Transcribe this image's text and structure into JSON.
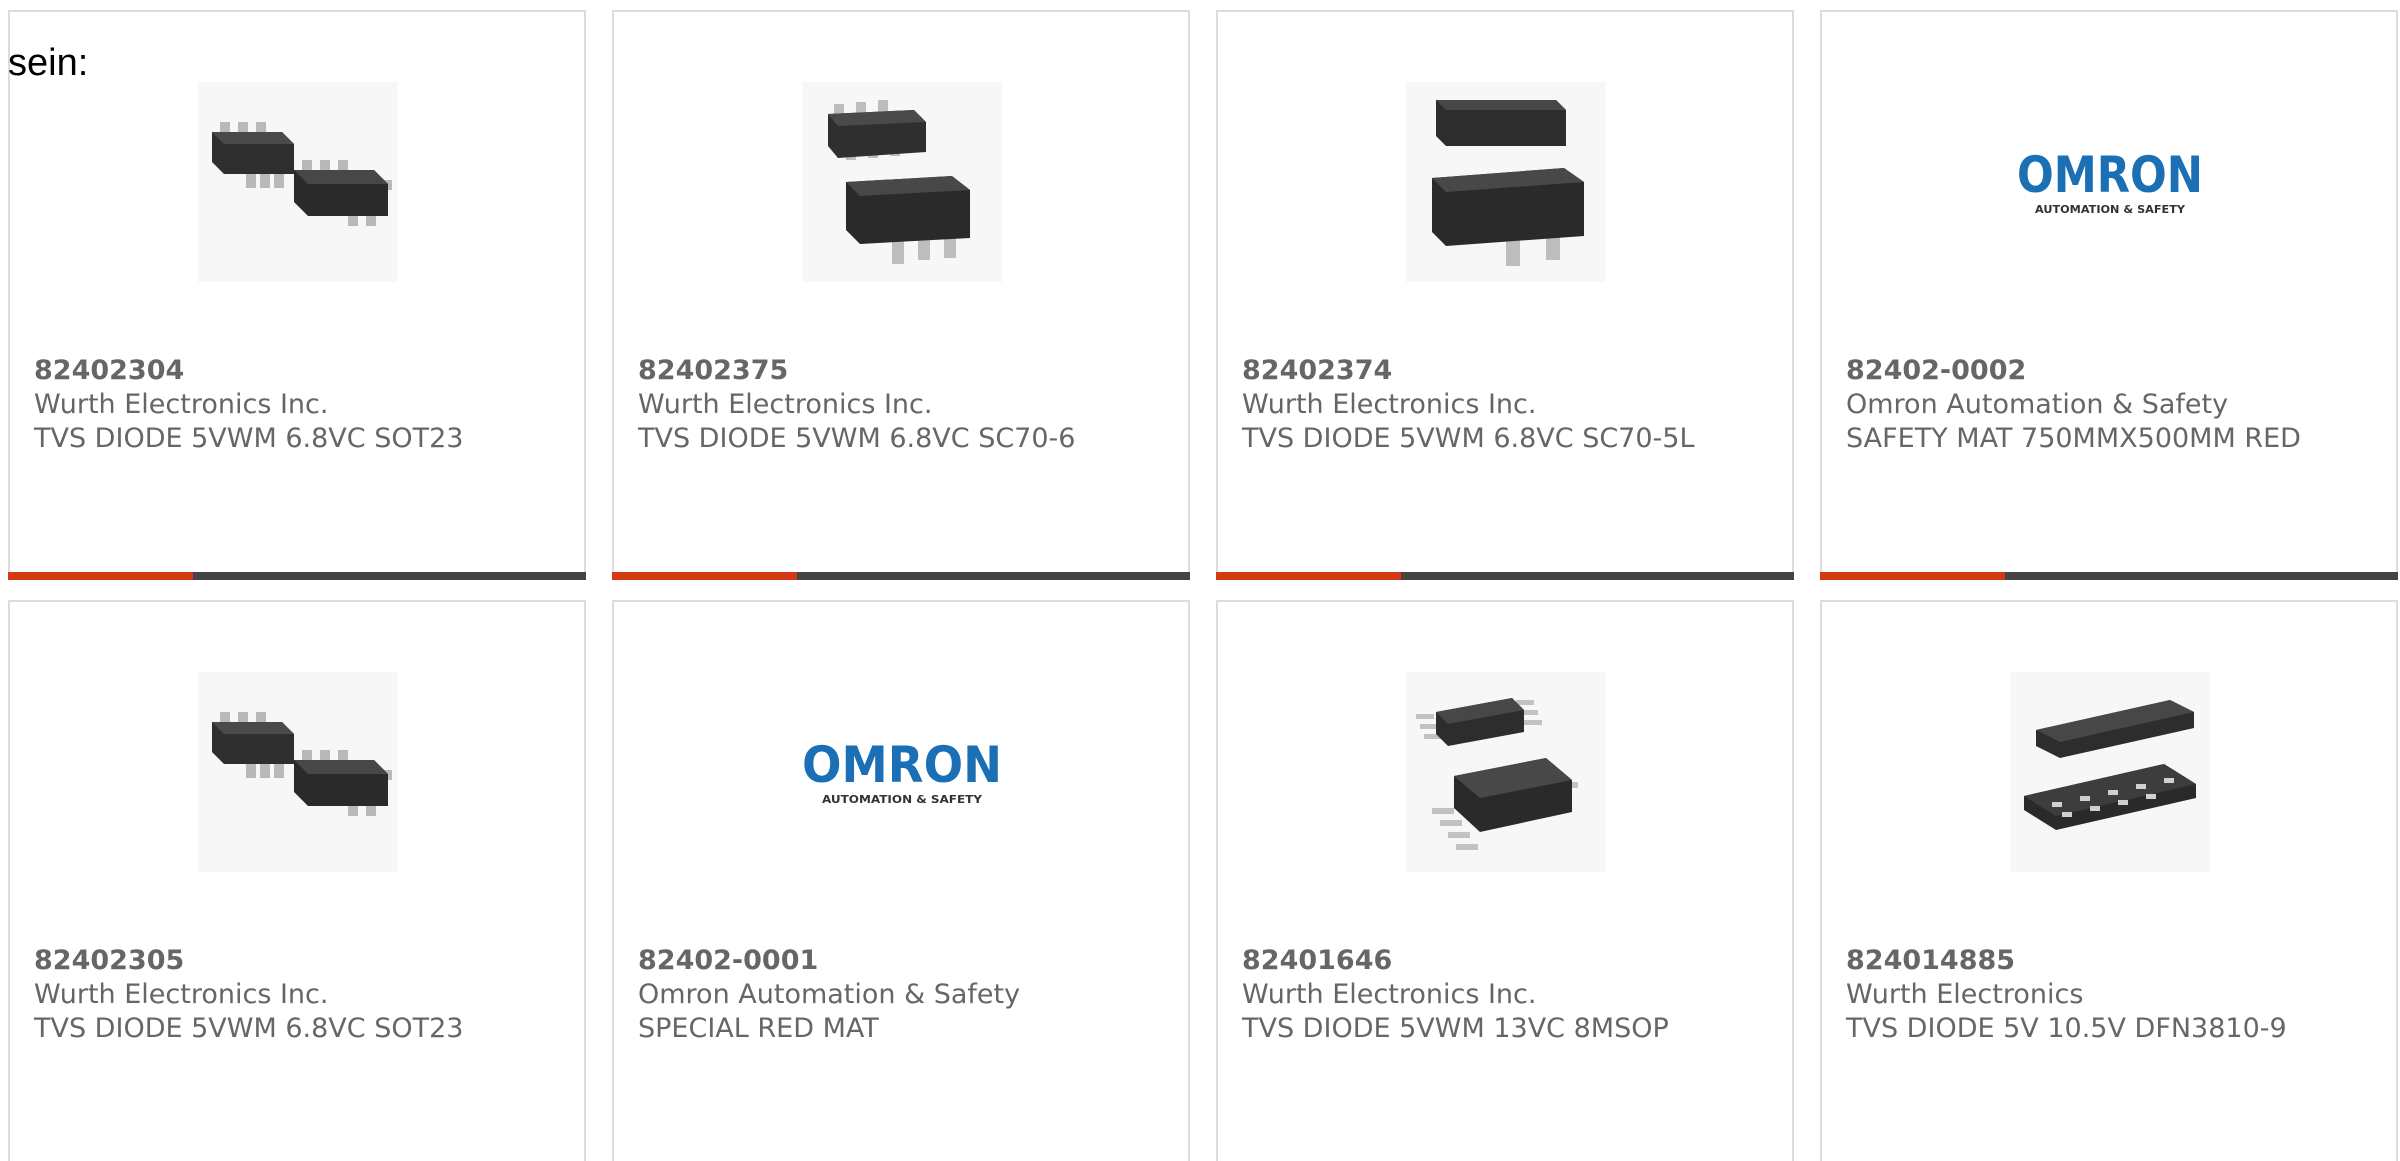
{
  "intro_text": "sein:",
  "colors": {
    "accent": "#d53a16",
    "bar_track": "#444444",
    "card_border": "#dcdcdc",
    "text": "#666666",
    "omron_blue": "#1b6fb5"
  },
  "products": [
    {
      "part_number": "82402304",
      "manufacturer": "Wurth Electronics Inc.",
      "description": "TVS DIODE 5VWM 6.8VC SOT23",
      "image": "sot23-6-package-icon",
      "progress": 0.32
    },
    {
      "part_number": "82402375",
      "manufacturer": "Wurth Electronics Inc.",
      "description": "TVS DIODE 5VWM 6.8VC SC70-6",
      "image": "sc70-6-package-icon",
      "progress": 0.32
    },
    {
      "part_number": "82402374",
      "manufacturer": "Wurth Electronics Inc.",
      "description": "TVS DIODE 5VWM 6.8VC SC70-5L",
      "image": "sc70-5-package-icon",
      "progress": 0.32
    },
    {
      "part_number": "82402-0002",
      "manufacturer": "Omron Automation & Safety",
      "description": "SAFETY MAT 750MMX500MM RED",
      "image": "omron-logo",
      "logo_text": "OMRON",
      "logo_subtext": "AUTOMATION & SAFETY",
      "progress": 0.32
    },
    {
      "part_number": "82402305",
      "manufacturer": "Wurth Electronics Inc.",
      "description": "TVS DIODE 5VWM 6.8VC SOT23",
      "image": "sot23-6-package-icon"
    },
    {
      "part_number": "82402-0001",
      "manufacturer": "Omron Automation & Safety",
      "description": "SPECIAL RED MAT",
      "image": "omron-logo",
      "logo_text": "OMRON",
      "logo_subtext": "AUTOMATION & SAFETY"
    },
    {
      "part_number": "82401646",
      "manufacturer": "Wurth Electronics Inc.",
      "description": "TVS DIODE 5VWM 13VC 8MSOP",
      "image": "msop-8-package-icon"
    },
    {
      "part_number": "824014885",
      "manufacturer": "Wurth Electronics",
      "description": "TVS DIODE 5V 10.5V DFN3810-9",
      "image": "dfn-package-icon"
    }
  ]
}
